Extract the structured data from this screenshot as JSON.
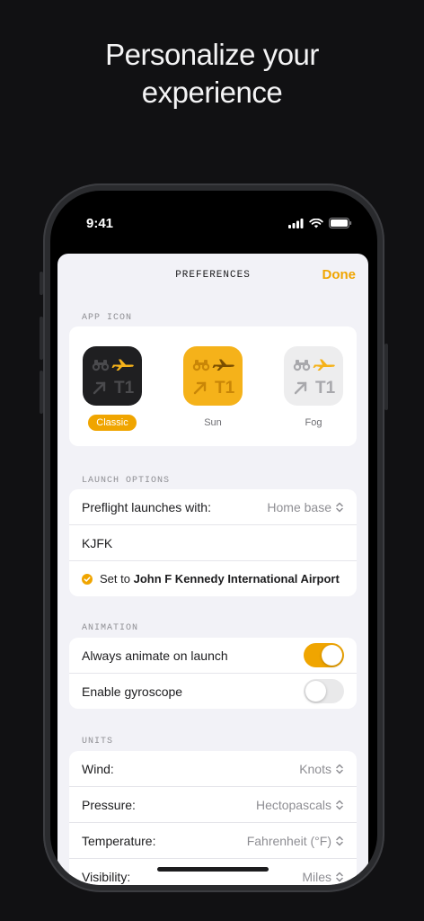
{
  "headline": {
    "line1": "Personalize your",
    "line2": "experience"
  },
  "status_bar": {
    "time": "9:41"
  },
  "nav": {
    "title": "PREFERENCES",
    "done_label": "Done"
  },
  "app_icon": {
    "section_label": "APP ICON",
    "icon_text": "T1",
    "options": [
      {
        "label": "Classic",
        "selected": true
      },
      {
        "label": "Sun",
        "selected": false
      },
      {
        "label": "Fog",
        "selected": false
      }
    ]
  },
  "launch_options": {
    "section_label": "LAUNCH OPTIONS",
    "preflight_label": "Preflight launches with:",
    "preflight_value": "Home base",
    "airport_code": "KJFK",
    "confirm_prefix": "Set to",
    "confirm_airport": "John F Kennedy International Airport"
  },
  "animation": {
    "section_label": "ANIMATION",
    "rows": [
      {
        "label": "Always animate on launch",
        "on": true
      },
      {
        "label": "Enable gyroscope",
        "on": false
      }
    ]
  },
  "units": {
    "section_label": "UNITS",
    "rows": [
      {
        "label": "Wind:",
        "value": "Knots"
      },
      {
        "label": "Pressure:",
        "value": "Hectopascals"
      },
      {
        "label": "Temperature:",
        "value": "Fahrenheit (°F)"
      },
      {
        "label": "Visibility:",
        "value": "Miles"
      }
    ]
  },
  "colors": {
    "accent": "#f0a500",
    "sheet_bg": "#f2f2f7",
    "page_bg": "#111113"
  }
}
